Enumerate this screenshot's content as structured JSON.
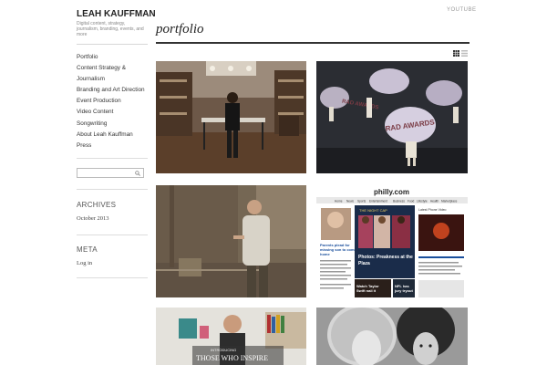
{
  "header": {
    "top_link": "YOUTUBE"
  },
  "sidebar": {
    "title": "LEAH KAUFFMAN",
    "tagline": "Digital content, strategy, journalism, branding, events, and more",
    "nav": [
      "Portfolio",
      "Content Strategy &",
      "Journalism",
      "Branding and Art Direction",
      "Event Production",
      "Video Content",
      "Songwriting",
      "About Leah Kauffman",
      "Press"
    ],
    "search_placeholder": "",
    "archives_title": "ARCHIVES",
    "archives_link": "October 2013",
    "meta_title": "META",
    "meta_link": "Log in"
  },
  "main": {
    "title": "portfolio",
    "view_icons": [
      "grid-view-icon",
      "list-view-icon"
    ],
    "tiles": [
      {
        "name": "store-photo"
      },
      {
        "name": "rad-awards-photo",
        "text": "RAD AWARDS"
      },
      {
        "name": "man-portrait-photo"
      },
      {
        "name": "philly-com-screenshot",
        "site": "philly.com",
        "nav": [
          "Home",
          "News",
          "Sports",
          "Entertainment",
          "Business",
          "Food",
          "Lifestyle",
          "Health",
          "Marketplace"
        ],
        "section": "THE NIGHT CAP",
        "headline": "Photos: Preakness at the Plaza",
        "story": "Parents plead for missing son to come home",
        "video": "Latest Phone Video",
        "bottom_left": "Watch Taylor Swift nail it",
        "bottom_right": "NFL has jury tryout"
      },
      {
        "name": "those-who-inspire-photo",
        "text": "THOSE WHO INSPIRE"
      },
      {
        "name": "two-women-bw-photo"
      }
    ]
  },
  "colors": {
    "accent": "#333333",
    "sidebar_rule": "#d8d8d8"
  }
}
